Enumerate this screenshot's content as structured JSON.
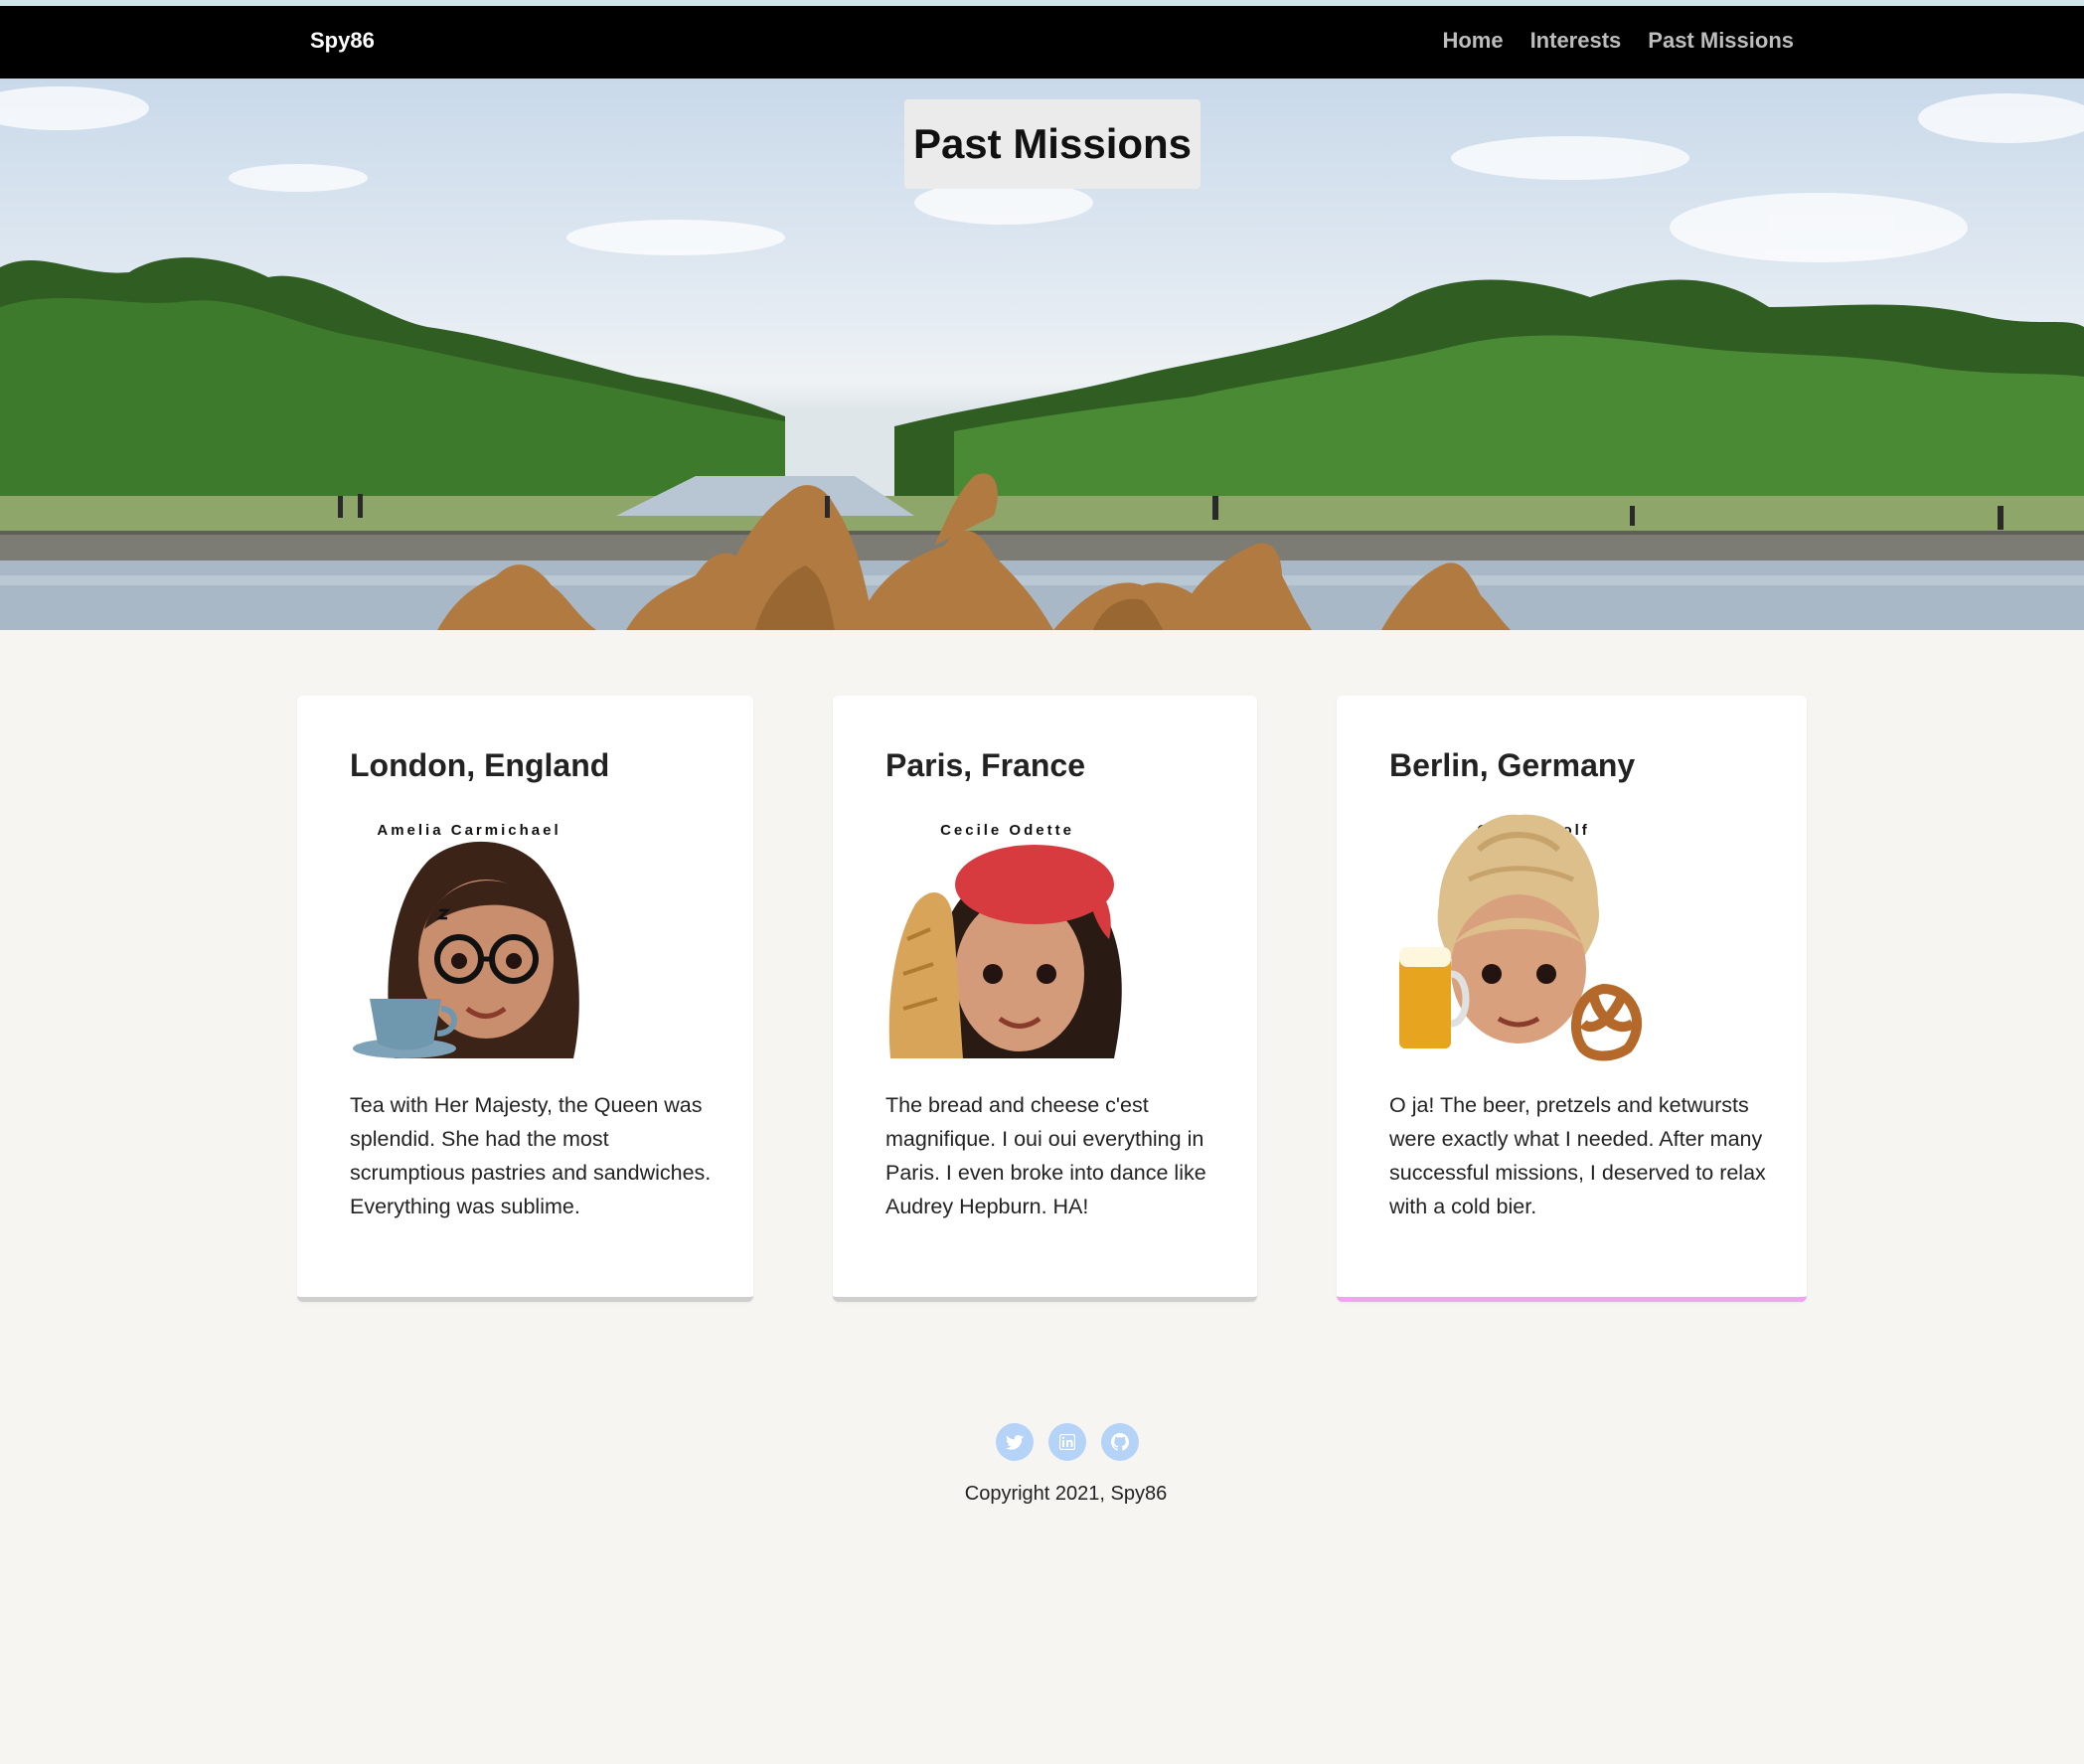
{
  "navbar": {
    "brand": "Spy86",
    "links": [
      "Home",
      "Interests",
      "Past Missions"
    ]
  },
  "hero": {
    "title": "Past Missions"
  },
  "cards": [
    {
      "title": "London, England",
      "agent": "Amelia Carmichael",
      "text": "Tea with Her Majesty, the Queen was splendid. She had the most scrumptious pastries and sandwiches. Everything was sublime."
    },
    {
      "title": "Paris, France",
      "agent": "Cecile Odette",
      "text": "The bread and cheese c'est magnifique. I oui oui everything in Paris. I even broke into dance like Audrey Hepburn. HA!"
    },
    {
      "title": "Berlin, Germany",
      "agent": "Gretta Wolf",
      "text": "O ja! The beer, pretzels and ketwursts were exactly what I needed. After many successful missions, I deserved to relax with a cold bier."
    }
  ],
  "footer": {
    "social_icons": [
      "twitter-icon",
      "linkedin-icon",
      "github-icon"
    ],
    "copyright": "Copyright 2021, Spy86"
  },
  "colors": {
    "navbar": "#000000",
    "page_background": "#f6f5f1",
    "social_icon": "#b5d3f7",
    "card_accent": "#f0a3f0"
  }
}
